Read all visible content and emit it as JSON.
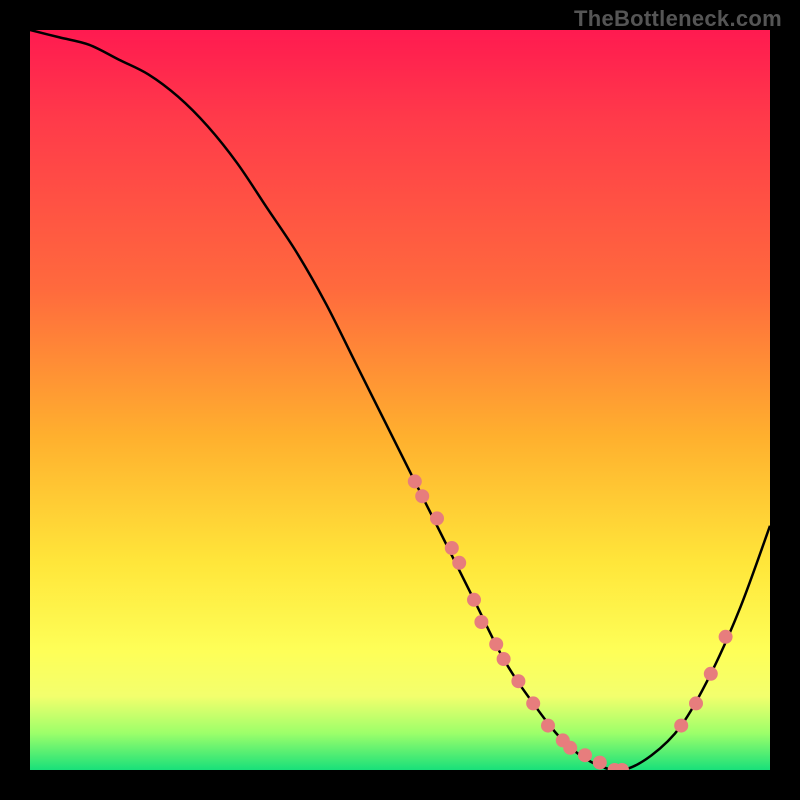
{
  "watermark": "TheBottleneck.com",
  "chart_data": {
    "type": "line",
    "title": "",
    "xlabel": "",
    "ylabel": "",
    "xlim": [
      0,
      100
    ],
    "ylim": [
      0,
      100
    ],
    "series": [
      {
        "name": "bottleneck-curve",
        "x": [
          0,
          4,
          8,
          12,
          16,
          20,
          24,
          28,
          32,
          36,
          40,
          44,
          48,
          52,
          56,
          60,
          64,
          68,
          72,
          76,
          80,
          84,
          88,
          92,
          96,
          100
        ],
        "values": [
          100,
          99,
          98,
          96,
          94,
          91,
          87,
          82,
          76,
          70,
          63,
          55,
          47,
          39,
          31,
          23,
          15,
          9,
          4,
          1,
          0,
          2,
          6,
          13,
          22,
          33
        ]
      }
    ],
    "data_points": {
      "name": "highlight-points",
      "x": [
        52,
        53,
        55,
        57,
        58,
        60,
        61,
        63,
        64,
        66,
        68,
        70,
        72,
        73,
        75,
        77,
        79,
        80,
        88,
        90,
        92,
        94
      ],
      "values": [
        39,
        37,
        34,
        30,
        28,
        23,
        20,
        17,
        15,
        12,
        9,
        6,
        4,
        3,
        2,
        1,
        0,
        0,
        6,
        9,
        13,
        18
      ]
    },
    "point_color": "#e77d7d",
    "curve_color": "#000000"
  }
}
